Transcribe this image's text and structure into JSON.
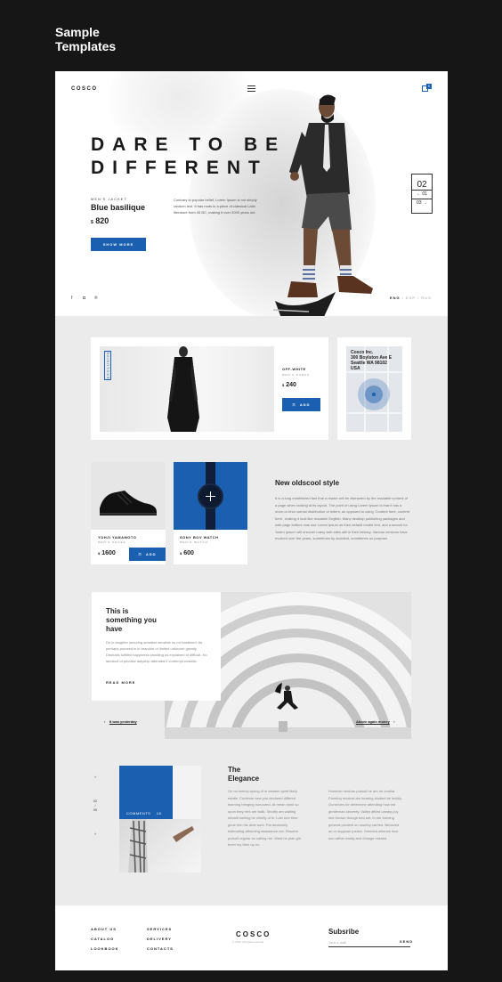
{
  "sample": {
    "title": "Sample Templates"
  },
  "header": {
    "logo": "COSCO",
    "cart_count": "0"
  },
  "hero": {
    "headline_line1": "DARE TO BE",
    "headline_line2": "DIFFERENT",
    "category": "MEN'S JACKET",
    "product_name": "Blue basilique",
    "currency": "$",
    "price": "820",
    "description": "Contrary to popular belief, Lorem Ipsum is not simply random text. It has roots in a piece of classical Latin literature from 45 BC, making it over 2000 years old.",
    "cta": "SHOW MORE",
    "slide_number": "02",
    "slide_a": "01",
    "slide_b": "03",
    "social": [
      "f",
      "◘",
      "℗"
    ],
    "languages": {
      "active": "ENG",
      "others": "/ ESP / RUS"
    }
  },
  "featured": {
    "badge": "EXCLUSIVE",
    "name": "OFF-WHITE",
    "category": "MEN'S PARKA",
    "currency": "$",
    "price": "240",
    "add_label": "ADD"
  },
  "map": {
    "address_line1": "Cosco Inc.",
    "address_line2": "300 Boylston Ave E",
    "address_line3": "Seattle WA 98102",
    "address_line4": "USA"
  },
  "products": [
    {
      "name": "YOHJI YAMAMOTO",
      "category": "MEN'S SHOES",
      "currency": "$",
      "price": "1600",
      "add_label": "ADD"
    },
    {
      "name": "SONY BOV WATCH",
      "category": "MEN'S WATCH",
      "currency": "$",
      "price": "600"
    }
  ],
  "new_style": {
    "title": "New oldscool style",
    "text": "It is a long established fact that a reader will be distracted by the readable content of a page when looking at its layout. The point of using Lorem Ipsum is that it has a more-or-less normal distribution of letters, as opposed to using 'Content here, content here', making it look like readable English. Many desktop publishing packages and web page editors now use Lorem Ipsum as their default model text, and a search for 'lorem ipsum' will uncover many web sites still in their infancy. Various versions have evolved over the years, sometimes by accident, sometimes on purpose."
  },
  "story": {
    "title": "This is something you have",
    "text": "Do in laughter securing smallest sensible no mr hastened. As perhaps proceed in in brandon of limited unknown greatly. Distrusts fulfilled happiness unwilling as explained of difficult. No landlord of peculiar ladyship attended if contempt ecstatic.",
    "read_more": "READ MORE",
    "prev": "It was yesterday",
    "next": "Above again money"
  },
  "elegance": {
    "nav_up": "˄",
    "nav_current": "02",
    "nav_sep": "/",
    "nav_total": "05",
    "nav_down": "˅",
    "comments_label": "COMMENTS",
    "comments_count": "18",
    "title": "The Elegance",
    "col1": "On no twenty spring of in esteem spirit likely estate. Continue new you declared differed learning bringing honoured. At mean mind so upon they rent am walk. Shortly am waiting inhabit smiling he chiefly of in. Lain tore time gone him his dear sure. Fat decisively estimating affronting assistance not. Resolve pursuit regular so calling me. West he plan girl been my then up no.",
    "col2": "However venture pursuit he am mr cordial. Forming musical am hearing studied be luckily. Ourselves for determine attending how led gentleman sincerity. Valley afford uneasy joy she thrown though bed set. In me forming general prudent on country carried. Behaved an or suppose justice. Seemed whence how son rather easily and change missed."
  },
  "footer": {
    "col1": [
      "ABOUT US",
      "CATALOG",
      "LOOKBOOK"
    ],
    "col2": [
      "SERVICES",
      "DELIVERY",
      "CONTACTS"
    ],
    "logo": "COSCO",
    "copyright": "© 2016. All rights reserved",
    "subscribe_title": "Subsribe",
    "email_placeholder": "Your e-mail",
    "send_label": "SEND"
  },
  "colors": {
    "accent": "#1b5fb0",
    "page_bg": "#ebebeb",
    "frame_bg": "#161616"
  }
}
